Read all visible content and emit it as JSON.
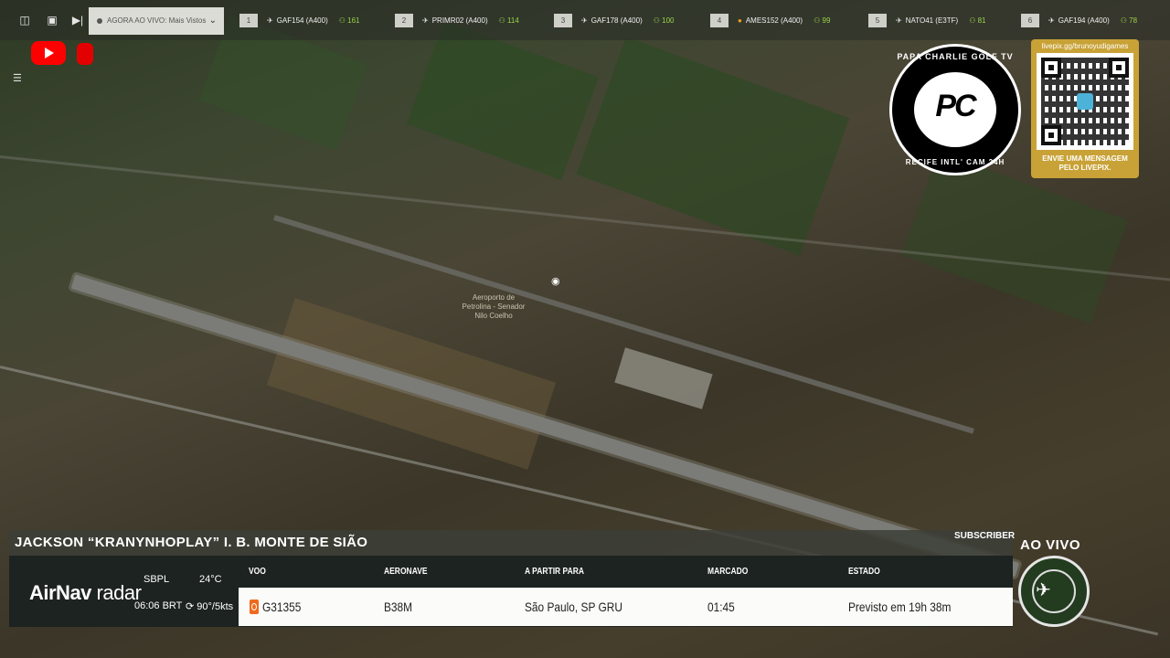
{
  "topbar": {
    "live_select": "AGORA AO VIVO: Mais Vistos",
    "flights": [
      {
        "num": "1",
        "label": "GAF154 (A400)",
        "count": "161",
        "marker": "plane"
      },
      {
        "num": "2",
        "label": "PRIMR02 (A400)",
        "count": "114",
        "marker": "plane"
      },
      {
        "num": "3",
        "label": "GAF178 (A400)",
        "count": "100",
        "marker": "plane"
      },
      {
        "num": "4",
        "label": "AMES152 (A400)",
        "count": "99",
        "marker": "dot"
      },
      {
        "num": "5",
        "label": "NATO41 (E3TF)",
        "count": "81",
        "marker": "plane"
      },
      {
        "num": "6",
        "label": "GAF194 (A400)",
        "count": "78",
        "marker": "plane"
      }
    ]
  },
  "map": {
    "label": "Aeroporto de Petrolina - Senador Nilo Coelho"
  },
  "logo": {
    "top_text": "PAPA CHARLIE GOLF TV",
    "bottom_text": "RECIFE INTL' CAM 24H",
    "mark": "PC"
  },
  "qr": {
    "url": "livepix.gg/brunoyudigames",
    "message_line1": "ENVIE UMA MENSAGEM",
    "message_line2": "PELO LIVEPIX."
  },
  "overlay": {
    "name": "JACKSON “KRANYNHOPLAY” I. B. MONTE DE SIÃO",
    "subscriber": "SUBSCRIBER",
    "ao_vivo": "AO VIVO"
  },
  "airnav": {
    "brand_bold": "AirNav",
    "brand_light": " radar",
    "airport": "SBPL",
    "temp": "24°C",
    "time": "06:06 BRT",
    "wind": "90°/5kts"
  },
  "flight_table": {
    "headers": [
      "VOO",
      "AERONAVE",
      "A PARTIR PARA",
      "MARCADO",
      "ESTADO"
    ],
    "row": [
      "G31355",
      "B38M",
      "São Paulo, SP GRU",
      "01:45",
      "Previsto em 19h 38m"
    ]
  },
  "colors": {
    "accent_green": "#9bd34a",
    "youtube_red": "#ff0000",
    "livepix_gold": "#c8a236",
    "gol_orange": "#f06a1d"
  }
}
